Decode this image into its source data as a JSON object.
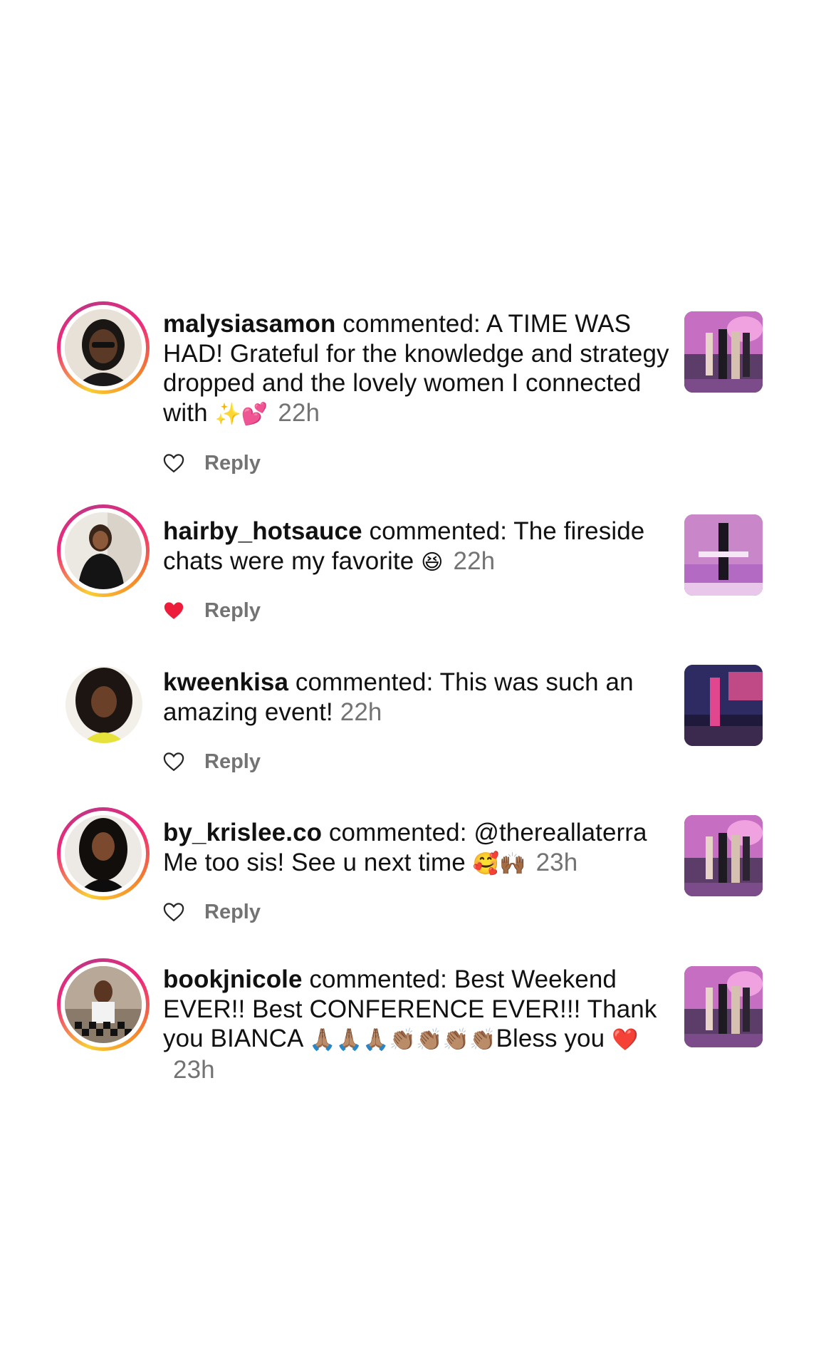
{
  "colors": {
    "text": "#111111",
    "muted": "#737373",
    "liked_heart": "#ed1c3a",
    "story_ring_start": "#f9ce34",
    "story_ring_mid": "#ee2a7b",
    "story_ring_end": "#c13584"
  },
  "notifications": [
    {
      "username": "malysiasamon",
      "action": " commented: ",
      "comment": "A TIME WAS HAD! Grateful for the knowledge and strategy dropped and the lovely women I connected with ",
      "emoji": "✨💕",
      "time": "22h",
      "liked": false,
      "reply_label": "Reply",
      "has_story_ring": true,
      "avatar_icon": "avatar-malysiasamon",
      "thumb_icon": "post-thumbnail"
    },
    {
      "username": "hairby_hotsauce",
      "action": " commented: ",
      "comment": "The fireside chats were my favorite ",
      "emoji": "😆",
      "time": "22h",
      "liked": true,
      "reply_label": "Reply",
      "has_story_ring": true,
      "avatar_icon": "avatar-hairby-hotsauce",
      "thumb_icon": "post-thumbnail"
    },
    {
      "username": "kweenkisa",
      "action": " commented: ",
      "comment": "This was such an amazing event!",
      "emoji": "",
      "time": "22h",
      "liked": false,
      "reply_label": "Reply",
      "has_story_ring": false,
      "avatar_icon": "avatar-kweenkisa",
      "thumb_icon": "post-thumbnail"
    },
    {
      "username": "by_krislee.co",
      "action": " commented: ",
      "comment": "@thereallaterra Me too sis! See u next time ",
      "emoji": "🥰🙌🏾",
      "time": "23h",
      "liked": false,
      "reply_label": "Reply",
      "has_story_ring": true,
      "avatar_icon": "avatar-by-krislee",
      "thumb_icon": "post-thumbnail"
    },
    {
      "username": "bookjnicole",
      "action": " commented: ",
      "comment": "Best Weekend EVER!! Best CONFERENCE EVER!!! Thank you BIANCA ",
      "emoji": "🙏🏽🙏🏽🙏🏽👏🏽👏🏽👏🏽👏🏽",
      "comment_tail": "Bless you ",
      "emoji_tail": "❤️",
      "time": "23h",
      "liked": false,
      "reply_label": "",
      "has_story_ring": true,
      "avatar_icon": "avatar-bookjnicole",
      "thumb_icon": "post-thumbnail"
    }
  ]
}
